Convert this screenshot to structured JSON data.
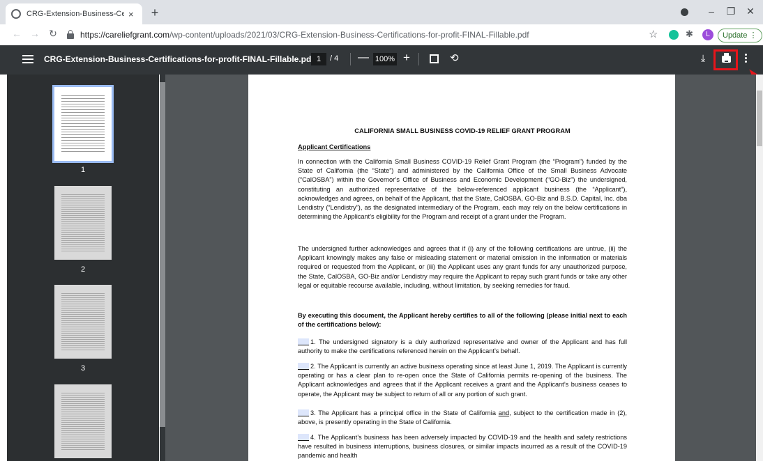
{
  "browser": {
    "tab_title": "CRG-Extension-Business-Certifica",
    "new_tab": "+",
    "tab_close": "×",
    "window_controls": {
      "minimize": "–",
      "maximize": "❐",
      "close": "✕"
    },
    "url_host": "https://careliefgrant.com",
    "url_path": "/wp-content/uploads/2021/03/CRG-Extension-Business-Certifications-for-profit-FINAL-Fillable.pdf",
    "avatar_letter": "L",
    "update_label": "Update ⋮"
  },
  "pdf_toolbar": {
    "file_name": "CRG-Extension-Business-Certifications-for-profit-FINAL-Fillable.pdf",
    "current_page": "1",
    "page_sep": "/  4",
    "zoom_minus": "—",
    "zoom": "100%",
    "zoom_plus": "+"
  },
  "thumbnails": [
    {
      "label": "1"
    },
    {
      "label": "2"
    },
    {
      "label": "3"
    }
  ],
  "document": {
    "title": "CALIFORNIA SMALL BUSINESS COVID-19 RELIEF GRANT PROGRAM",
    "subtitle": "Applicant Certifications",
    "p1": "In connection with the California Small Business COVID-19 Relief Grant Program (the “Program”) funded by the State of California (the “State”) and administered by the California Office of the Small Business Advocate (“CalOSBA”) within the Governor’s Office of Business and Economic Development (“GO-Biz”) the undersigned, constituting an authorized representative of the below-referenced applicant business (the “Applicant”), acknowledges and agrees, on behalf of the Applicant, that the State, CalOSBA, GO-Biz and B.S.D. Capital, Inc. dba Lendistry (“Lendistry”), as the designated intermediary of the Program, each may rely on the below certifications in determining the Applicant’s eligibility for the Program and receipt of a grant under the Program.",
    "p2": "The undersigned further acknowledges and agrees that if (i) any of the following certifications are untrue, (ii) the Applicant knowingly makes any false or misleading statement or material omission in the information or materials required or requested from the Applicant, or (iii) the Applicant uses any grant funds for any unauthorized purpose, the State, CalOSBA, GO-Biz and/or Lendistry may require the Applicant to repay such grant funds or take any other legal or equitable recourse available, including, without limitation, by seeking remedies for fraud.",
    "p3": "By executing this document, the Applicant hereby certifies to all of the following (please initial next to each of the certifications below):",
    "c1": "1. The undersigned signatory is a duly authorized representative and owner of the Applicant and has full authority to make the certifications referenced herein on the Applicant’s behalf.",
    "c2": "2. The Applicant is currently an active business operating since at least June 1, 2019. The Applicant is currently operating or has a clear plan to re-open once the State of California permits re-opening of the business. The Applicant acknowledges and agrees that if the Applicant receives a grant and the Applicant’s business ceases to operate, the Applicant may be subject to return of all or any portion of such grant.",
    "c3a": "3. The Applicant has a principal office in the State of California ",
    "c3b": "and",
    "c3c": ", subject to the certification made in (2), above, is presently operating in the State of California.",
    "c4": "4. The Applicant’s business has been adversely impacted by COVID-19 and the health and safety restrictions have resulted in business interruptions, business closures, or similar impacts incurred as a result of the COVID-19 pandemic and health"
  }
}
